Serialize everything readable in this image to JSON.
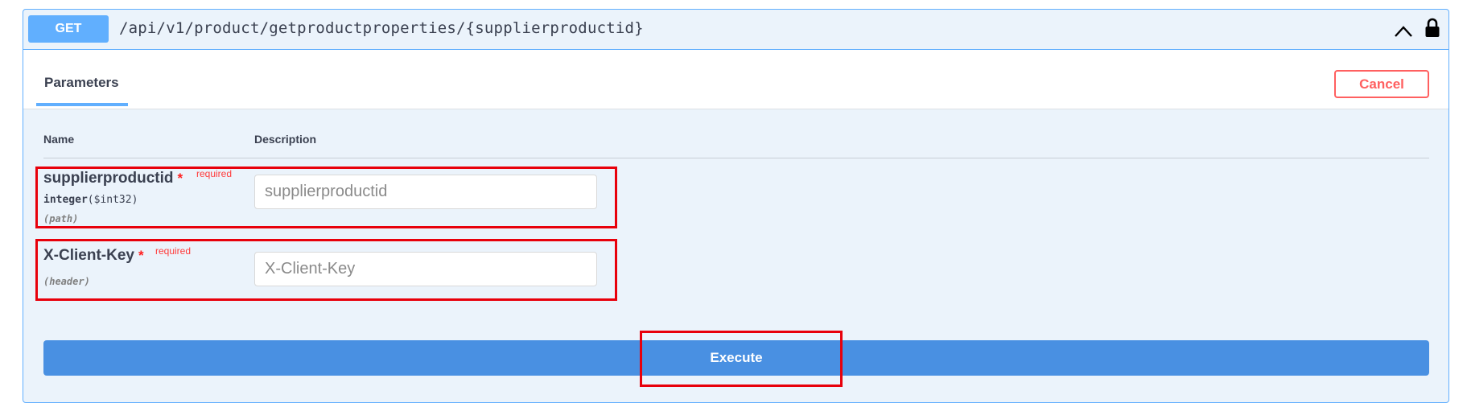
{
  "operation": {
    "method": "GET",
    "path": "/api/v1/product/getproductproperties/{supplierproductid}",
    "collapse_icon": "chevron-up-icon",
    "auth_icon": "lock-icon"
  },
  "tabs": {
    "active": "Parameters",
    "cancel_label": "Cancel"
  },
  "table": {
    "headers": [
      "Name",
      "Description"
    ]
  },
  "parameters": [
    {
      "name": "supplierproductid",
      "required_mark": "*",
      "required_label": "required",
      "type": "integer",
      "format": "($int32)",
      "location": "(path)",
      "placeholder": "supplierproductid",
      "value": ""
    },
    {
      "name": "X-Client-Key",
      "required_mark": "*",
      "required_label": "required",
      "location": "(header)",
      "placeholder": "X-Client-Key",
      "value": ""
    }
  ],
  "execute_label": "Execute",
  "colors": {
    "accent": "#61affe",
    "execute": "#4990e2",
    "cancel": "#ff6060",
    "highlight": "#e8000b"
  }
}
